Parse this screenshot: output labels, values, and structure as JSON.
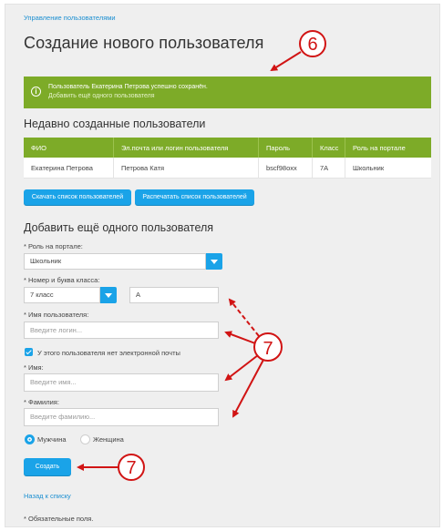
{
  "breadcrumb": "Управление пользователями",
  "page_title": "Создание нового пользователя",
  "alert": {
    "icon": "info-circle-icon",
    "message": "Пользователь Екатерина Петрова успешно сохранён.",
    "link": "Добавить ещё одного пользователя",
    "color": "#7dab28"
  },
  "recent": {
    "heading": "Недавно созданные пользователи",
    "columns": [
      "ФИО",
      "Эл.почта или логин пользователя",
      "Пароль",
      "Класс",
      "Роль на портале"
    ],
    "rows": [
      [
        "Екатерина Петрова",
        "Петрова Катя",
        "bscf98oxx",
        "7А",
        "Школьник"
      ]
    ]
  },
  "buttons": {
    "download_list": "Скачать список пользователей",
    "print_list": "Распечатать список пользователей",
    "create": "Создать"
  },
  "form": {
    "heading": "Добавить ещё одного пользователя",
    "role_label": "* Роль на портале:",
    "role_value": "Школьник",
    "class_label": "* Номер и буква класса:",
    "class_number": "7 класс",
    "class_letter": "А",
    "username_label": "* Имя пользователя:",
    "username_placeholder": "Введите логин...",
    "no_email_label": "У этого пользователя нет электронной почты",
    "no_email_checked": true,
    "first_name_label": "* Имя:",
    "first_name_placeholder": "Введите имя...",
    "last_name_label": "* Фамилия:",
    "last_name_placeholder": "Введите фамилию...",
    "gender_male": "Мужчина",
    "gender_female": "Женщина",
    "gender_selected": "male"
  },
  "back_link": "Назад к списку",
  "required_note": "* Обязательные поля.",
  "callouts": {
    "six": "6",
    "seven": "7",
    "color": "#d11414"
  },
  "accent_color": "#1aa3e8"
}
